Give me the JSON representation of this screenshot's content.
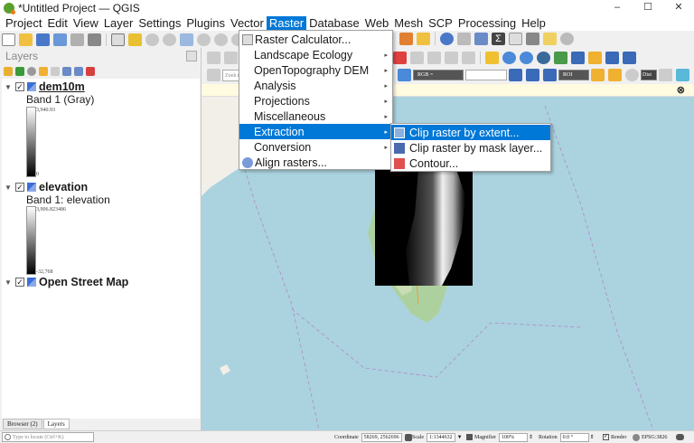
{
  "window": {
    "title": "*Untitled Project — QGIS",
    "controls": [
      "–",
      "☐",
      "✕"
    ]
  },
  "menubar": {
    "items": [
      "Project",
      "Edit",
      "View",
      "Layer",
      "Settings",
      "Plugins",
      "Vector",
      "Raster",
      "Database",
      "Web",
      "Mesh",
      "SCP",
      "Processing",
      "Help"
    ],
    "active": "Raster"
  },
  "raster_menu": {
    "items": [
      {
        "label": "Raster Calculator...",
        "icon": "calculator-icon",
        "submenu": false
      },
      {
        "label": "Landscape Ecology",
        "icon": "",
        "submenu": true
      },
      {
        "label": "OpenTopography DEM",
        "icon": "",
        "submenu": true
      },
      {
        "label": "Analysis",
        "icon": "",
        "submenu": true
      },
      {
        "label": "Projections",
        "icon": "",
        "submenu": true
      },
      {
        "label": "Miscellaneous",
        "icon": "",
        "submenu": true
      },
      {
        "label": "Extraction",
        "icon": "",
        "submenu": true,
        "highlighted": true
      },
      {
        "label": "Conversion",
        "icon": "",
        "submenu": true
      },
      {
        "label": "Align rasters...",
        "icon": "align-icon",
        "submenu": false
      }
    ]
  },
  "extraction_submenu": {
    "items": [
      {
        "label": "Clip raster by extent...",
        "icon": "clip-extent-icon",
        "highlighted": true
      },
      {
        "label": "Clip raster by mask layer...",
        "icon": "clip-mask-icon"
      },
      {
        "label": "Contour...",
        "icon": "contour-icon"
      }
    ]
  },
  "layers_panel": {
    "title": "Layers",
    "layers": [
      {
        "name": "dem10m",
        "band": "Band 1 (Gray)",
        "max": "3,940.93",
        "min": "0"
      },
      {
        "name": "elevation",
        "band": "Band 1: elevation",
        "max": "3,906.823486",
        "min": "-32,768"
      },
      {
        "name": "Open Street Map"
      }
    ],
    "tabs": [
      "Browser (2)",
      "Layers"
    ]
  },
  "map_toolbar": {
    "zoom_placeholder": "Zoek in PDOK",
    "rgb_combo": "RGB =",
    "roi_combo": "ROI",
    "dist_label": "Dist"
  },
  "statusbar": {
    "locator_placeholder": "Type to locate (Ctrl+K)",
    "coordinate_label": "Coordinate",
    "coordinate_value": "58269, 2562696",
    "scale_label": "Scale",
    "scale_value": "1:1344632",
    "magnifier_label": "Magnifier",
    "magnifier_value": "100%",
    "rotation_label": "Rotation",
    "rotation_value": "0.0 °",
    "render_label": "Render",
    "crs": "EPSG:3826"
  },
  "colors": {
    "accent": "#0078d7",
    "sea": "#aad3df",
    "land": "#f2efe9",
    "forest": "#add19e"
  }
}
